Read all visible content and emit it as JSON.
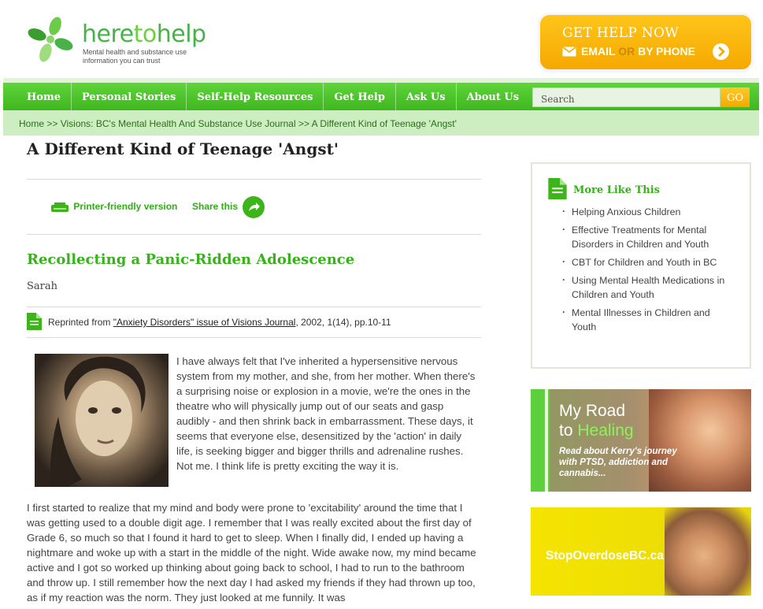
{
  "header": {
    "logo_word_here": "here",
    "logo_word_to": "to",
    "logo_word_help": "help",
    "logo_tagline": "Mental health and substance use information you can trust",
    "help_now_title": "GET HELP NOW",
    "help_now_email": "EMAIL",
    "help_now_or": "OR",
    "help_now_phone": "BY PHONE",
    "accent_color": "#f5a800"
  },
  "nav": {
    "items": [
      "Home",
      "Personal Stories",
      "Self-Help Resources",
      "Get Help",
      "Ask Us",
      "About Us"
    ],
    "search_placeholder": "Search",
    "go_label": "GO",
    "nav_color": "#3fb71f"
  },
  "breadcrumb": {
    "home": "Home",
    "sep": ">>",
    "journal": "Visions: BC's Mental Health And Substance Use Journal",
    "current": "A Different Kind of Teenage 'Angst'"
  },
  "article": {
    "title": "A Different Kind of Teenage 'Angst'",
    "print_label": "Printer-friendly version",
    "share_label": "Share this",
    "subtitle": "Recollecting a Panic-Ridden Adolescence",
    "author": "Sarah",
    "reprint_prefix": "Reprinted from ",
    "reprint_link": "\"Anxiety Disorders\" issue of Visions Journal",
    "reprint_suffix": ", 2002, 1(14), pp.10-11",
    "para1": "I have always felt that I've inherited a hypersensitive nervous system from my mother, and she, from her mother. When there's a surprising noise or explosion in a movie, we're the ones in the theatre who will physically jump out of our seats and gasp audibly - and then shrink back in embarrassment. These days, it seems that everyone else, desensitized by the 'action' in daily life, is seeking bigger and bigger thrills and adrenaline rushes. Not me. I think life is pretty exciting the way it is.",
    "para2": "I first started to realize that my mind and body were prone to 'excitability' around the time that I was getting used to a double digit age. I remember that I was really excited about the first day of Grade 6, so much so that I found it hard to get to sleep. When I finally did, I ended up having a nightmare and woke up with a start in the middle of the night. Wide awake now, my mind became active and I got so worked up thinking about going back to school, I had to run to the bathroom and throw up. I still remember how the next day I had asked my friends if they had thrown up too, as if my reaction was the norm. They just looked at me funnily. It was"
  },
  "sidebar": {
    "more_title": "More Like This",
    "more_items": [
      "Helping Anxious Children",
      "Effective Treatments for Mental Disorders in Children and Youth",
      "CBT for Children and Youth in BC",
      "Using Mental Health Medications in Children and Youth",
      "Mental Illnesses in Children and Youth"
    ],
    "promo1_line1": "My Road",
    "promo1_to": "to",
    "promo1_healing": "Healing",
    "promo1_sub": "Read about Kerry's journey with PTSD, addiction and cannabis...",
    "promo2_text": "StopOverdoseBC.ca"
  }
}
